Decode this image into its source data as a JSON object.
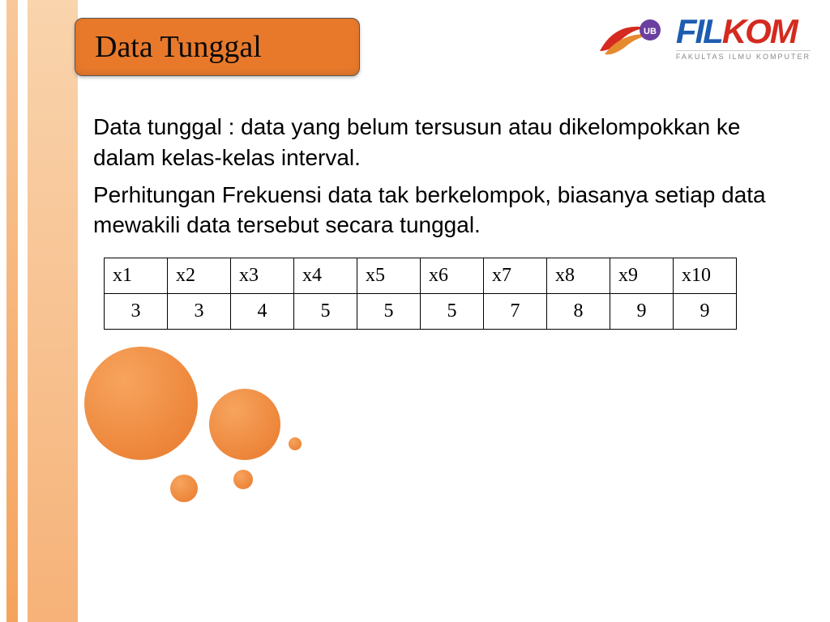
{
  "title": "Data Tunggal",
  "logo": {
    "part1": "FIL",
    "part2": "KOM",
    "ub_badge": "UB",
    "subtitle": "FAKULTAS ILMU KOMPUTER"
  },
  "paragraphs": [
    "Data tunggal : data yang belum tersusun atau dikelompokkan ke dalam kelas-kelas interval.",
    "Perhitungan Frekuensi data tak berkelompok, biasanya setiap data mewakili data tersebut secara tunggal."
  ],
  "chart_data": {
    "type": "table",
    "headers": [
      "x1",
      "x2",
      "x3",
      "x4",
      "x5",
      "x6",
      "x7",
      "x8",
      "x9",
      "x10"
    ],
    "values": [
      3,
      3,
      4,
      5,
      5,
      5,
      7,
      8,
      9,
      9
    ]
  }
}
